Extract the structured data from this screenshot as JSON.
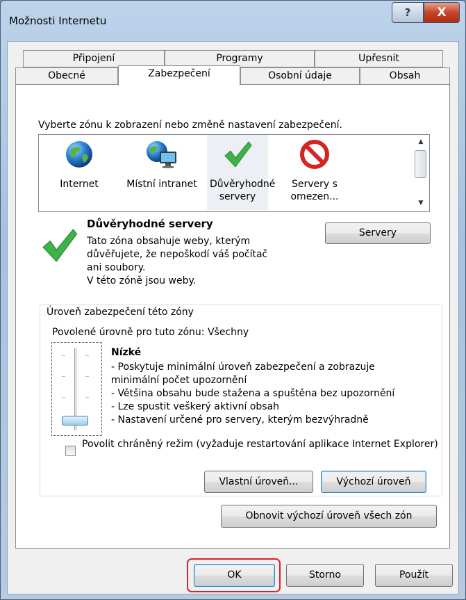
{
  "window": {
    "title": "Možnosti Internetu",
    "help_glyph": "?",
    "close_glyph": "X"
  },
  "tabs": {
    "row_back": [
      "Připojení",
      "Programy",
      "Upřesnit"
    ],
    "row_front": [
      "Obecné",
      "Zabezpečení",
      "Osobní údaje",
      "Obsah"
    ],
    "active": "Zabezpečení"
  },
  "zones": {
    "instruction": "Vyberte zónu k zobrazení nebo změně nastavení zabezpečení.",
    "items": [
      {
        "label": "Internet",
        "icon": "globe-icon"
      },
      {
        "label": "Místní intranet",
        "icon": "intranet-icon"
      },
      {
        "label": "Důvěryhodné servery",
        "icon": "checkmark-icon",
        "selected": true
      },
      {
        "label": "Servery s omezen...",
        "icon": "restricted-icon"
      }
    ]
  },
  "zone_info": {
    "title": "Důvěryhodné servery",
    "body_lines": [
      "Tato zóna obsahuje weby, kterým",
      "důvěřujete, že nepoškodí váš počítač",
      "ani soubory.",
      "V této zóně jsou weby."
    ],
    "sites_button": "Servery"
  },
  "security_level": {
    "group_label": "Úroveň zabezpečení této zóny",
    "allowed_levels": "Povolené úrovně pro tuto zónu: Všechny",
    "slider_position_fraction": 0.0,
    "level_name": "Nízké",
    "level_lines": [
      "- Poskytuje minimální úroveň zabezpečení a zobrazuje",
      "minimální počet upozornění",
      "- Většina obsahu bude stažena a spuštěna bez upozornění",
      "- Lze spustit veškerý aktivní obsah",
      "- Nastavení určené pro servery, kterým bezvýhradně"
    ],
    "protected_mode_label": "Povolit chráněný režim (vyžaduje restartování aplikace Internet Explorer)",
    "protected_mode_checked": false,
    "custom_level_button": "Vlastní úroveň...",
    "default_level_button": "Výchozí úroveň"
  },
  "reset_all_button": "Obnovit výchozí úroveň všech zón",
  "footer": {
    "ok": "OK",
    "cancel": "Storno",
    "apply": "Použít"
  },
  "colors": {
    "highlight": "#e0202a",
    "accent": "#3c7fb1"
  }
}
